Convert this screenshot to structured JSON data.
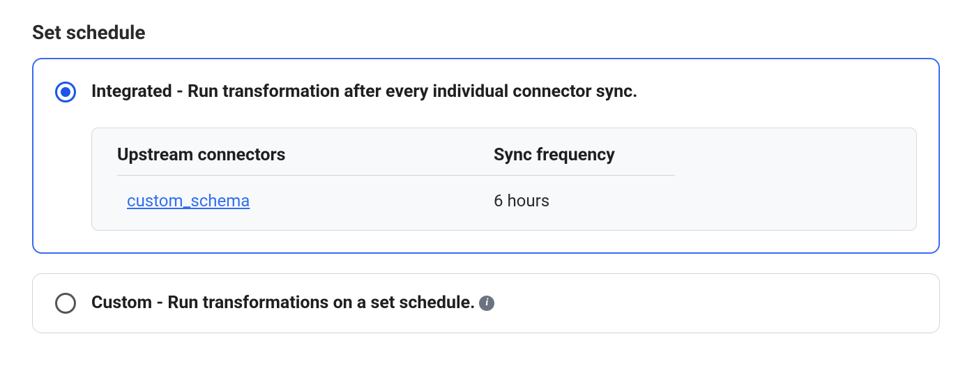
{
  "section": {
    "title": "Set schedule"
  },
  "options": {
    "integrated": {
      "label": "Integrated - Run transformation after every individual connector sync.",
      "selected": true,
      "table": {
        "headers": {
          "name": "Upstream connectors",
          "freq": "Sync frequency"
        },
        "rows": [
          {
            "name": "custom_schema",
            "freq": "6 hours"
          }
        ]
      }
    },
    "custom": {
      "label": "Custom - Run transformations on a set schedule.",
      "selected": false
    }
  }
}
